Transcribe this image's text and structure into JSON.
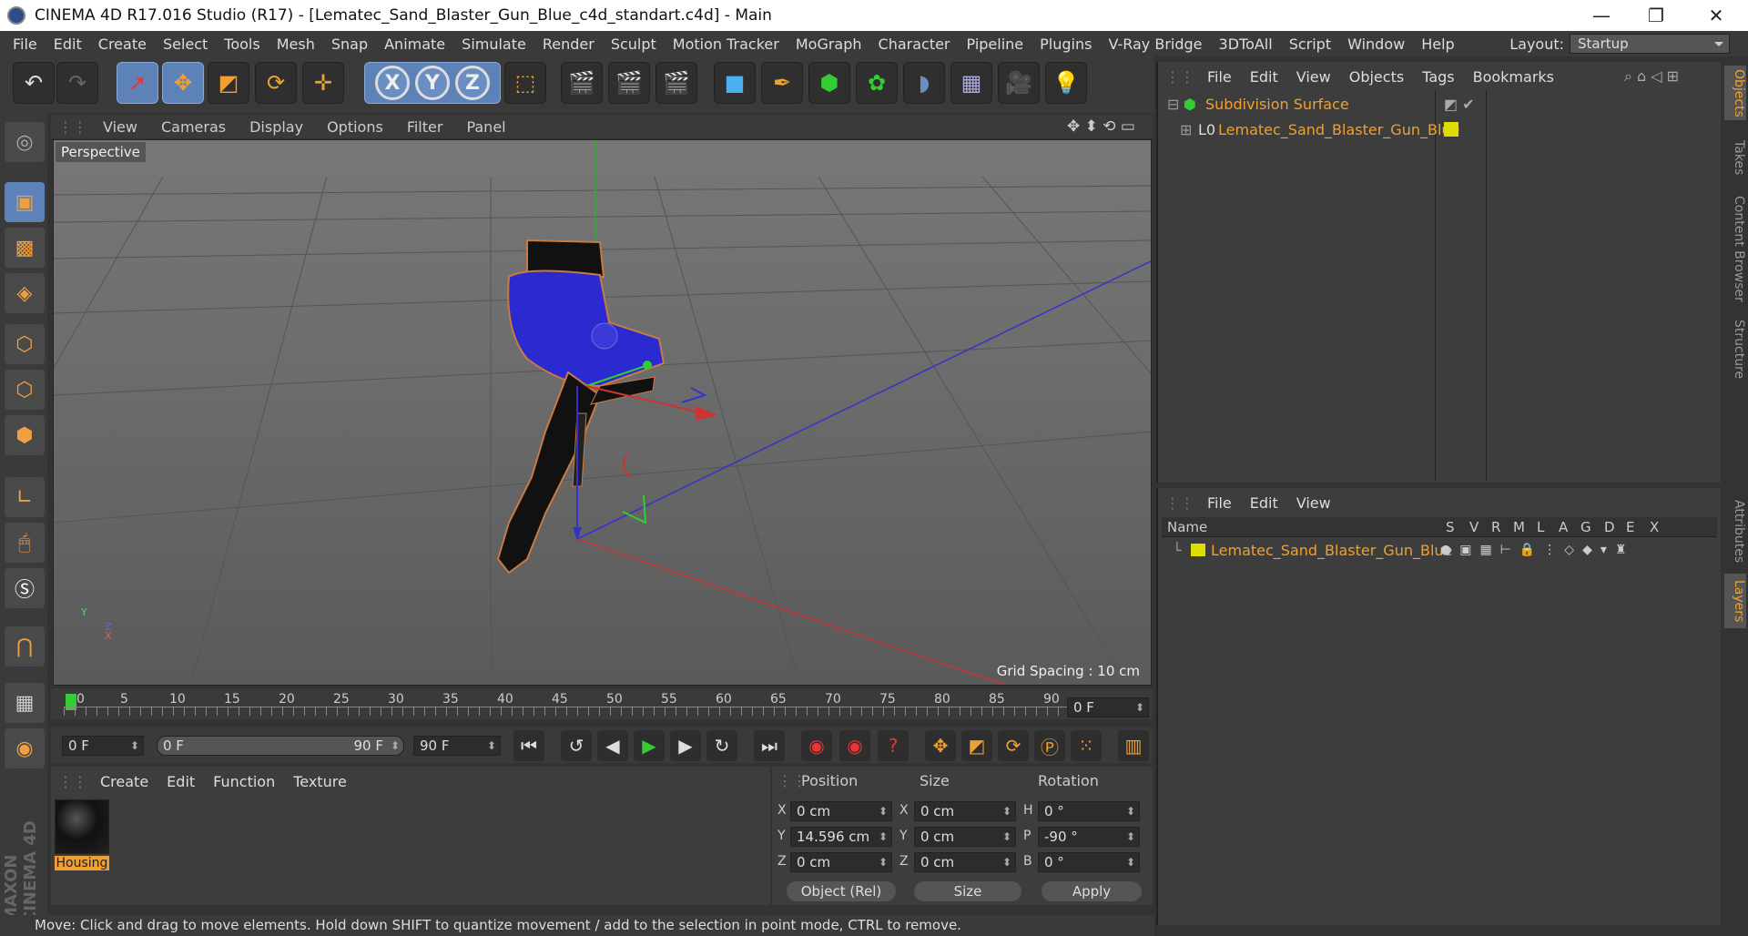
{
  "window": {
    "title": "CINEMA 4D R17.016 Studio (R17) - [Lematec_Sand_Blaster_Gun_Blue_c4d_standart.c4d] - Main",
    "minimize": "—",
    "maximize": "❐",
    "close": "✕"
  },
  "menu": [
    "File",
    "Edit",
    "Create",
    "Select",
    "Tools",
    "Mesh",
    "Snap",
    "Animate",
    "Simulate",
    "Render",
    "Sculpt",
    "Motion Tracker",
    "MoGraph",
    "Character",
    "Pipeline",
    "Plugins",
    "V-Ray Bridge",
    "3DToAll",
    "Script",
    "Window",
    "Help"
  ],
  "layout": {
    "label": "Layout:",
    "value": "Startup"
  },
  "toolbar": {
    "x": "X",
    "y": "Y",
    "z": "Z"
  },
  "viewport": {
    "menu": [
      "View",
      "Cameras",
      "Display",
      "Options",
      "Filter",
      "Panel"
    ],
    "label": "Perspective",
    "grid_spacing": "Grid Spacing : 10 cm",
    "axis_x": "X",
    "axis_y": "Y",
    "axis_z": "Z"
  },
  "objects_panel": {
    "menu": [
      "File",
      "Edit",
      "View",
      "Objects",
      "Tags",
      "Bookmarks"
    ],
    "items": [
      {
        "name": "Subdivision Surface"
      },
      {
        "name": "Lematec_Sand_Blaster_Gun_Blue"
      }
    ]
  },
  "layers_panel": {
    "menu": [
      "File",
      "Edit",
      "View"
    ],
    "columns": [
      "Name",
      "S",
      "V",
      "R",
      "M",
      "L",
      "A",
      "G",
      "D",
      "E",
      "X"
    ],
    "rows": [
      {
        "name": "Lematec_Sand_Blaster_Gun_Blue"
      }
    ]
  },
  "side_tabs": [
    "Objects",
    "Takes",
    "Content Browser",
    "Structure",
    "Attributes",
    "Layers"
  ],
  "timeline": {
    "ticks": [
      "0",
      "5",
      "10",
      "15",
      "20",
      "25",
      "30",
      "35",
      "40",
      "45",
      "50",
      "55",
      "60",
      "65",
      "70",
      "75",
      "80",
      "85",
      "90"
    ],
    "current": "0 F"
  },
  "transport": {
    "start": "0 F",
    "range_start": "0 F",
    "range_end": "90 F",
    "end": "90 F"
  },
  "materials": {
    "menu": [
      "Create",
      "Edit",
      "Function",
      "Texture"
    ],
    "items": [
      {
        "name": "Housing"
      }
    ]
  },
  "coords": {
    "headers": [
      "Position",
      "Size",
      "Rotation"
    ],
    "rows": [
      {
        "pl": "X",
        "p": "0 cm",
        "sl": "X",
        "s": "0 cm",
        "rl": "H",
        "r": "0 °"
      },
      {
        "pl": "Y",
        "p": "14.596 cm",
        "sl": "Y",
        "s": "0 cm",
        "rl": "P",
        "r": "-90 °"
      },
      {
        "pl": "Z",
        "p": "0 cm",
        "sl": "Z",
        "s": "0 cm",
        "rl": "B",
        "r": "0 °"
      }
    ],
    "mode": "Object (Rel)",
    "size_mode": "Size",
    "apply": "Apply"
  },
  "status": "Move: Click and drag to move elements. Hold down SHIFT to quantize movement / add to the selection in point mode, CTRL to remove.",
  "brand": "MAXON CINEMA 4D",
  "colors": {
    "accent": "#f0a030",
    "blue": "#3a3ad0"
  }
}
